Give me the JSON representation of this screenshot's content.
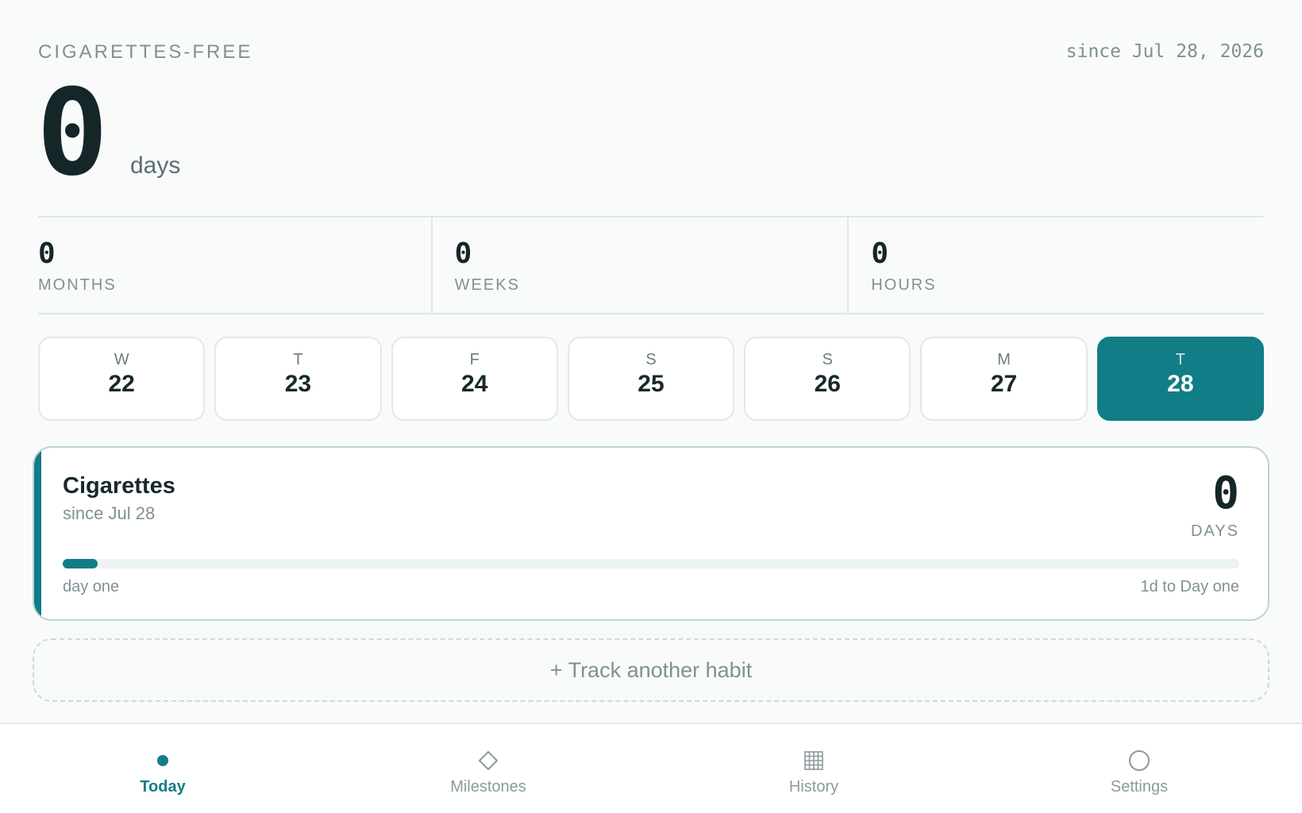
{
  "header": {
    "label": "CIGARETTES-FREE",
    "since": "since Jul 28, 2026",
    "count": "0",
    "unit": "days"
  },
  "stats": [
    {
      "value": "0",
      "label": "MONTHS"
    },
    {
      "value": "0",
      "label": "WEEKS"
    },
    {
      "value": "0",
      "label": "HOURS"
    }
  ],
  "days": [
    {
      "letter": "W",
      "num": "22",
      "active": false
    },
    {
      "letter": "T",
      "num": "23",
      "active": false
    },
    {
      "letter": "F",
      "num": "24",
      "active": false
    },
    {
      "letter": "S",
      "num": "25",
      "active": false
    },
    {
      "letter": "S",
      "num": "26",
      "active": false
    },
    {
      "letter": "M",
      "num": "27",
      "active": false
    },
    {
      "letter": "T",
      "num": "28",
      "active": true
    }
  ],
  "habit": {
    "title": "Cigarettes",
    "since": "since Jul 28",
    "count": "0",
    "unit": "DAYS",
    "progress": 0.03,
    "foot_left": "day one",
    "foot_right": "1d to Day one"
  },
  "add_habit_label": "+ Track another habit",
  "nav": {
    "items": [
      {
        "label": "Today",
        "icon": "dot-icon",
        "active": true
      },
      {
        "label": "Milestones",
        "icon": "diamond-icon",
        "active": false
      },
      {
        "label": "History",
        "icon": "grid-icon",
        "active": false
      },
      {
        "label": "Settings",
        "icon": "circle-icon",
        "active": false
      }
    ]
  },
  "colors": {
    "accent": "#117d86",
    "background": "#f9fbfb",
    "text": "#17282b",
    "muted": "#7f9194"
  }
}
